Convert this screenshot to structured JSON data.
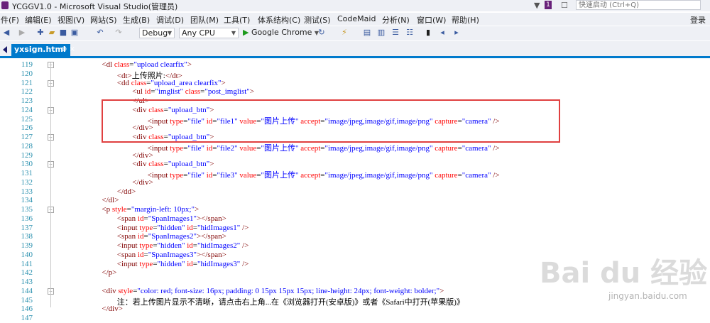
{
  "window": {
    "title": "YCGGV1.0 - Microsoft Visual Studio(管理员)",
    "notification_count": "1",
    "quick_launch_placeholder": "快速启动 (Ctrl+Q)"
  },
  "menu": {
    "items": [
      "件(F)",
      "编辑(E)",
      "视图(V)",
      "网站(S)",
      "生成(B)",
      "调试(D)",
      "团队(M)",
      "工具(T)",
      "体系结构(C)",
      "测试(S)",
      "CodeMaid",
      "分析(N)",
      "窗口(W)",
      "帮助(H)"
    ],
    "login": "登录"
  },
  "toolbar": {
    "configuration": "Debug",
    "platform": "Any CPU",
    "run_target": "Google Chrome"
  },
  "tab": {
    "label": "yxsign.html",
    "pin": "⊕ ×"
  },
  "code_lines": [
    {
      "num": "119",
      "fold": "−",
      "indent": 2,
      "html": "<span class='t'>&lt;dl</span> <span class='a'>class</span>=<span class='v'>\"upload clearfix\"</span><span class='t'>&gt;</span>"
    },
    {
      "num": "120",
      "fold": "",
      "indent": 4,
      "html": "<span class='t'>&lt;dt&gt;</span><span class='tx'>上传照片:</span><span class='t'>&lt;/dt&gt;</span>"
    },
    {
      "num": "121",
      "fold": "−",
      "indent": 4,
      "html": "<span class='t'>&lt;dd</span> <span class='a'>class</span>=<span class='v'>\"upload_area clearfix\"</span><span class='t'>&gt;</span>"
    },
    {
      "num": "122",
      "fold": "",
      "indent": 6,
      "html": "<span class='t'>&lt;ul</span> <span class='a'>id</span>=<span class='v'>\"imglist\"</span> <span class='a'>class</span>=<span class='v'>\"post_imglist\"</span><span class='t'>&gt;</span>"
    },
    {
      "num": "123",
      "fold": "",
      "indent": 6,
      "html": "<span class='t'>&lt;/ul&gt;</span>"
    },
    {
      "num": "124",
      "fold": "−",
      "indent": 6,
      "html": "<span class='t'>&lt;div</span> <span class='a'>class</span>=<span class='v'>\"upload_btn\"</span><span class='t'>&gt;</span>"
    },
    {
      "num": "125",
      "fold": "",
      "indent": 8,
      "html": "<span class='t'>&lt;input</span> <span class='a'>type</span>=<span class='v'>\"file\"</span> <span class='a'>id</span>=<span class='v'>\"file1\"</span> <span class='a'>value</span>=<span class='v'>\"图片上传\"</span> <span class='a'>accept</span>=<span class='v'>\"image/jpeg,image/gif,image/png\"</span> <span class='a'>capture</span>=<span class='v'>\"camera\"</span> <span class='t'>/&gt;</span>"
    },
    {
      "num": "126",
      "fold": "",
      "indent": 6,
      "html": "<span class='t'>&lt;/div&gt;</span>"
    },
    {
      "num": "127",
      "fold": "−",
      "indent": 6,
      "html": "<span class='t'>&lt;div</span> <span class='a'>class</span>=<span class='v'>\"upload_btn\"</span><span class='t'>&gt;</span>"
    },
    {
      "num": "128",
      "fold": "",
      "indent": 8,
      "html": "<span class='t'>&lt;input</span> <span class='a'>type</span>=<span class='v'>\"file\"</span> <span class='a'>id</span>=<span class='v'>\"file2\"</span> <span class='a'>value</span>=<span class='v'>\"图片上传\"</span> <span class='a'>accept</span>=<span class='v'>\"image/jpeg,image/gif,image/png\"</span> <span class='a'>capture</span>=<span class='v'>\"camera\"</span> <span class='t'>/&gt;</span>"
    },
    {
      "num": "129",
      "fold": "",
      "indent": 6,
      "html": "<span class='t'>&lt;/div&gt;</span>"
    },
    {
      "num": "130",
      "fold": "−",
      "indent": 6,
      "html": "<span class='t'>&lt;div</span> <span class='a'>class</span>=<span class='v'>\"upload_btn\"</span><span class='t'>&gt;</span>"
    },
    {
      "num": "131",
      "fold": "",
      "indent": 8,
      "html": "<span class='t'>&lt;input</span> <span class='a'>type</span>=<span class='v'>\"file\"</span> <span class='a'>id</span>=<span class='v'>\"file3\"</span> <span class='a'>value</span>=<span class='v'>\"图片上传\"</span> <span class='a'>accept</span>=<span class='v'>\"image/jpeg,image/gif,image/png\"</span> <span class='a'>capture</span>=<span class='v'>\"camera\"</span> <span class='t'>/&gt;</span>"
    },
    {
      "num": "132",
      "fold": "",
      "indent": 6,
      "html": "<span class='t'>&lt;/div&gt;</span>"
    },
    {
      "num": "133",
      "fold": "",
      "indent": 4,
      "html": "<span class='t'>&lt;/dd&gt;</span>"
    },
    {
      "num": "134",
      "fold": "",
      "indent": 2,
      "html": "<span class='t'>&lt;/dl&gt;</span>"
    },
    {
      "num": "135",
      "fold": "−",
      "indent": 2,
      "html": "<span class='t'>&lt;p</span> <span class='a'>style</span>=<span class='v'>\"margin-left: 10px;\"</span><span class='t'>&gt;</span>"
    },
    {
      "num": "136",
      "fold": "",
      "indent": 4,
      "html": "<span class='t'>&lt;span</span> <span class='a'>id</span>=<span class='v'>\"SpanImages1\"</span><span class='t'>&gt;&lt;/span&gt;</span>"
    },
    {
      "num": "137",
      "fold": "",
      "indent": 4,
      "html": "<span class='t'>&lt;input</span> <span class='a'>type</span>=<span class='v'>\"hidden\"</span> <span class='a'>id</span>=<span class='v'>\"hidImages1\"</span> <span class='t'>/&gt;</span>"
    },
    {
      "num": "138",
      "fold": "",
      "indent": 4,
      "html": "<span class='t'>&lt;span</span> <span class='a'>id</span>=<span class='v'>\"SpanImages2\"</span><span class='t'>&gt;&lt;/span&gt;</span>"
    },
    {
      "num": "139",
      "fold": "",
      "indent": 4,
      "html": "<span class='t'>&lt;input</span> <span class='a'>type</span>=<span class='v'>\"hidden\"</span> <span class='a'>id</span>=<span class='v'>\"hidImages2\"</span> <span class='t'>/&gt;</span>"
    },
    {
      "num": "140",
      "fold": "",
      "indent": 4,
      "html": "<span class='t'>&lt;span</span> <span class='a'>id</span>=<span class='v'>\"SpanImages3\"</span><span class='t'>&gt;&lt;/span&gt;</span>"
    },
    {
      "num": "141",
      "fold": "",
      "indent": 4,
      "html": "<span class='t'>&lt;input</span> <span class='a'>type</span>=<span class='v'>\"hidden\"</span> <span class='a'>id</span>=<span class='v'>\"hidImages3\"</span> <span class='t'>/&gt;</span>"
    },
    {
      "num": "142",
      "fold": "",
      "indent": 2,
      "html": "<span class='t'>&lt;/p&gt;</span>"
    },
    {
      "num": "143",
      "fold": "",
      "indent": 0,
      "html": ""
    },
    {
      "num": "144",
      "fold": "−",
      "indent": 2,
      "html": "<span class='t'>&lt;div</span> <span class='a'>style</span>=<span class='v'>\"color: red; font-size: 16px; padding: 0 15px 15px 15px; line-height: 24px; font-weight: bolder;\"</span><span class='t'>&gt;</span>"
    },
    {
      "num": "145",
      "fold": "",
      "indent": 4,
      "html": "<span class='tx'>注：若上传图片显示不清晰，请点击右上角...在《浏览器打开(安卓版)》或者《Safari中打开(苹果版)》</span>"
    },
    {
      "num": "146",
      "fold": "",
      "indent": 2,
      "html": "<span class='t'>&lt;/div&gt;</span>"
    },
    {
      "num": "147",
      "fold": "",
      "indent": 0,
      "html": ""
    }
  ],
  "watermark": {
    "brand": "Bai du 经验",
    "url": "jingyan.baidu.com"
  }
}
